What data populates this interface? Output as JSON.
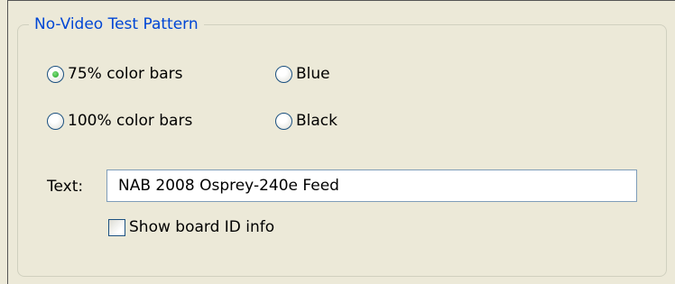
{
  "group": {
    "title": "No-Video Test Pattern"
  },
  "pattern_options": [
    {
      "label": "75% color bars",
      "selected": true
    },
    {
      "label": "Blue",
      "selected": false
    },
    {
      "label": "100% color bars",
      "selected": false
    },
    {
      "label": "Black",
      "selected": false
    }
  ],
  "text_field": {
    "label": "Text:",
    "value": "NAB 2008 Osprey-240e Feed"
  },
  "show_board_id": {
    "label": "Show board ID info",
    "checked": false
  },
  "colors": {
    "group_title": "#0046d5",
    "background": "#ece9d8",
    "radio_selected": "#21a121"
  }
}
